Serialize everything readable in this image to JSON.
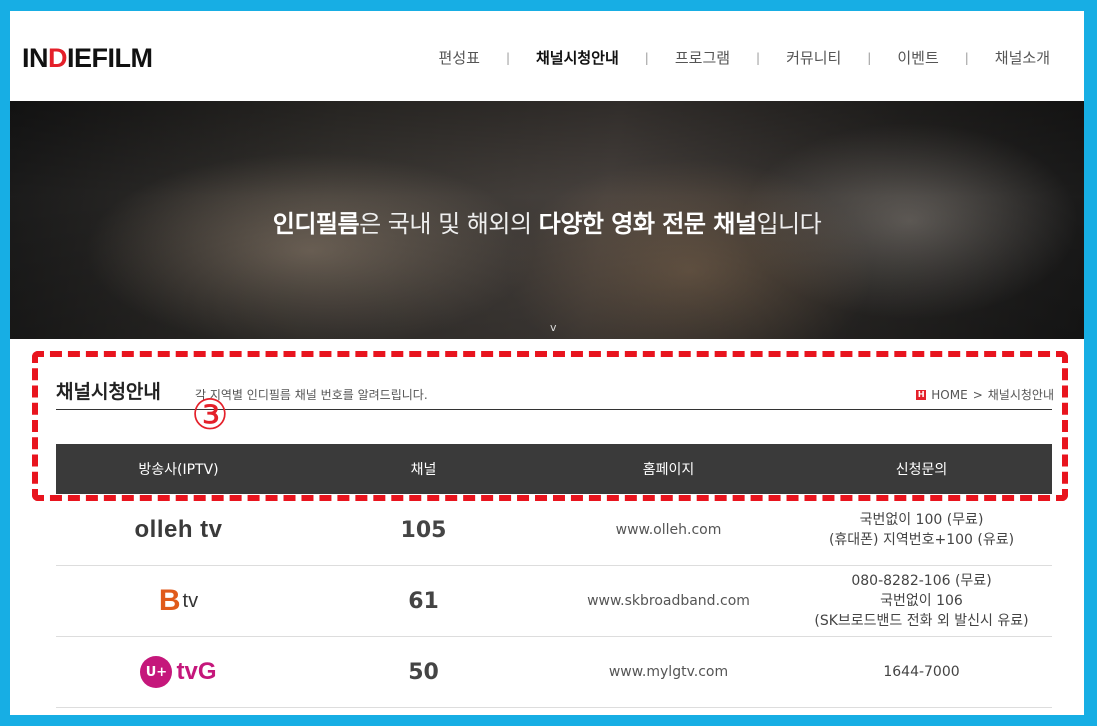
{
  "header": {
    "logo_text": "INDIEFILM",
    "nav": [
      "편성표",
      "채널시청안내",
      "프로그램",
      "커뮤니티",
      "이벤트",
      "채널소개"
    ],
    "nav_active": "채널시청안내",
    "separator": "|"
  },
  "hero": {
    "bold1": "인디필름",
    "text1": "은 국내 및 해외의 ",
    "bold2": "다양한 영화 전문 채널",
    "text2": "입니다",
    "scroll_glyph": "v"
  },
  "section": {
    "title": "채널시청안내",
    "subtitle": "각 지역별 인디필름 채널 번호를 알려드립니다.",
    "breadcrumb_home_icon": "H",
    "breadcrumb_home": "HOME",
    "breadcrumb_sep": ">",
    "breadcrumb_current": "채널시청안내",
    "annotation_marker": "③"
  },
  "table": {
    "headers": [
      "방송사(IPTV)",
      "채널",
      "홈페이지",
      "신청문의"
    ],
    "rows": [
      {
        "logo": "olleh tv",
        "channel": "105",
        "url": "www.olleh.com",
        "inquiry": [
          "국번없이 100 (무료)",
          "(휴대폰) 지역번호+100 (유료)"
        ]
      },
      {
        "logo_b": "B",
        "logo_tv": "tv",
        "channel": "61",
        "url": "www.skbroadband.com",
        "inquiry": [
          "080-8282-106 (무료)",
          "국번없이 106",
          "(SK브로드밴드 전화 외 발신시 유료)"
        ]
      },
      {
        "logo_u": "U+",
        "logo_tvg": "tvG",
        "channel": "50",
        "url": "www.mylgtv.com",
        "inquiry": [
          "1644-7000"
        ]
      }
    ]
  },
  "colors": {
    "accent": "#e4202a",
    "frame": "#17aee4",
    "annotation": "#e8141e"
  }
}
